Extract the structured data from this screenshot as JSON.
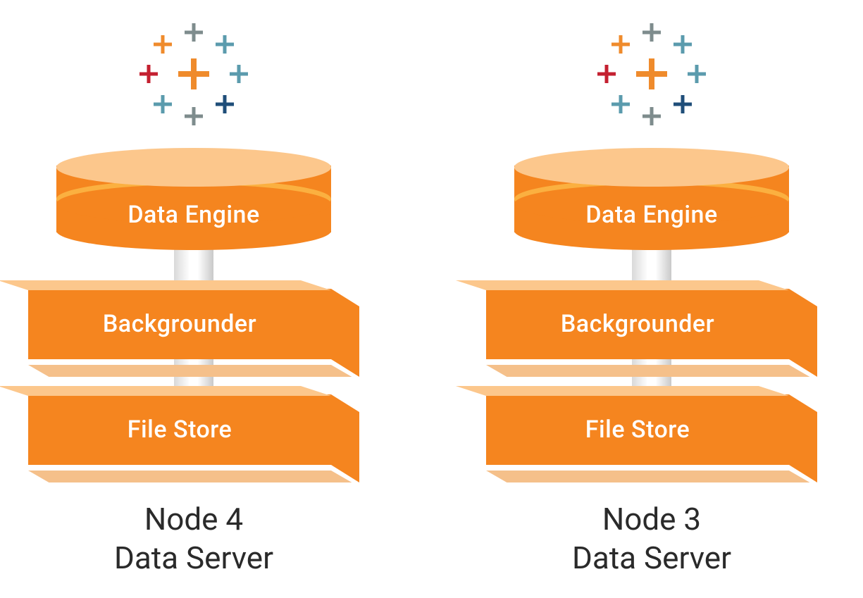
{
  "colors": {
    "orange": "#f5851f",
    "orange_light": "#fcc78c",
    "orange_mid": "#fbb040",
    "text_dark": "#2a2a2a",
    "logo_orange": "#ef8b2c",
    "logo_red": "#c42030",
    "logo_navy": "#1f4e79",
    "logo_teal": "#5b9bad",
    "logo_gray": "#7e8c8d"
  },
  "nodes": [
    {
      "id": "node4",
      "disk_label": "Data Engine",
      "slab1_label": "Backgrounder",
      "slab2_label": "File Store",
      "caption_line1": "Node 4",
      "caption_line2": "Data Server"
    },
    {
      "id": "node3",
      "disk_label": "Data Engine",
      "slab1_label": "Backgrounder",
      "slab2_label": "File Store",
      "caption_line1": "Node 3",
      "caption_line2": "Data Server"
    }
  ]
}
